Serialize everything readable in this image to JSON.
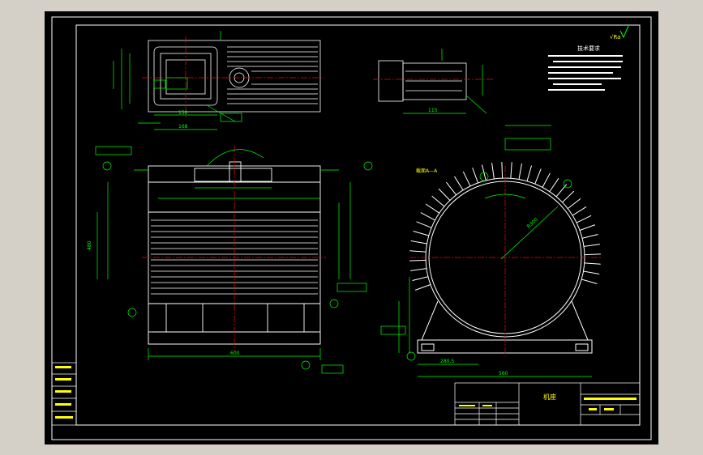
{
  "colors": {
    "background_outer": "#d4d0c8",
    "sheet": "#000000",
    "frame": "#ffffff",
    "drawing": "#ffffff",
    "dimension": "#00ff00",
    "centerline": "#ff0000",
    "accent_yellow": "#ffff00"
  },
  "labels": {
    "section_label": "截面A—A",
    "roughness_symbol": "√Ra",
    "tech_requirements_title": "技术要求",
    "title_block_name": "机座",
    "scale_label": "1:1"
  },
  "dimensions": {
    "top_view_1": "150",
    "top_view_2": "168",
    "front_width": "600",
    "front_height": "480",
    "right_width": "560",
    "right_base": "280.5",
    "radius": "R300",
    "detail_width": "115"
  }
}
